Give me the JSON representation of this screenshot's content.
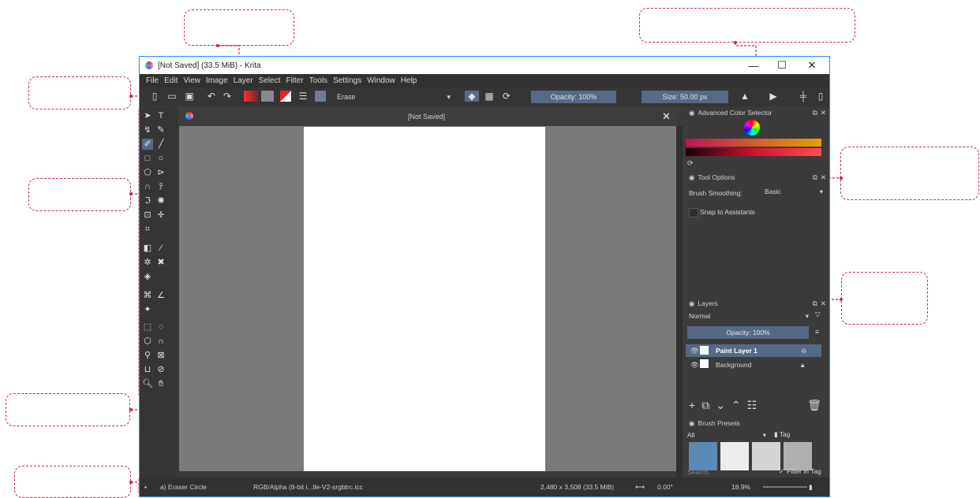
{
  "window": {
    "title": "[Not Saved]  (33.5 MiB)  - Krita",
    "controls": [
      "—",
      "☐",
      "✕"
    ]
  },
  "menubar": {
    "items": [
      "File",
      "Edit",
      "View",
      "Image",
      "Layer",
      "Select",
      "Filter",
      "Tools",
      "Settings",
      "Window",
      "Help"
    ]
  },
  "toolbar": {
    "blend_mode": "Erase",
    "opacity": "Opacity: 100%",
    "size": "Size: 50.00 px"
  },
  "document": {
    "tab_title": "[Not Saved]",
    "close": "✕"
  },
  "dockers": {
    "color_selector": {
      "title": "Advanced Color Selector"
    },
    "tool_options": {
      "title": "Tool Options",
      "brush_smoothing_label": "Brush Smoothing:",
      "brush_smoothing_value": "Basic",
      "snap_label": "Snap to Assistants"
    },
    "layers": {
      "title": "Layers",
      "blend_mode": "Normal",
      "opacity": "Opacity:  100%",
      "items": [
        {
          "name": "Paint Layer 1",
          "selected": true
        },
        {
          "name": "Background",
          "selected": false
        }
      ]
    },
    "brush_presets": {
      "title": "Brush Presets",
      "filter": "All",
      "tag": "Tag",
      "search_placeholder": "Search",
      "filter_in_tag": "Filter in Tag"
    }
  },
  "statusbar": {
    "brush": "a) Eraser Circle",
    "color_space": "RGB/Alpha (8-bit i...lle-V2-srgbtrc.icc",
    "dimensions": "2,480 x 3,508 (33.5 MiB)",
    "rotation": "0.00°",
    "zoom": "18.9%"
  },
  "colors": {
    "accent": "#c8284e",
    "window_border": "#1e90ff",
    "panel": "#3b3b3b",
    "selection": "#566a86"
  }
}
